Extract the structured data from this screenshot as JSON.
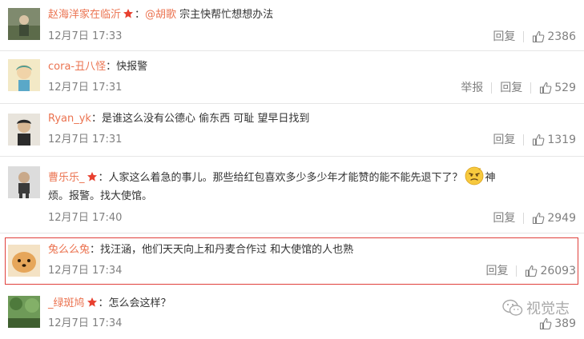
{
  "comments": [
    {
      "username": "赵海洋家在临沂",
      "separator": "：",
      "mention": "@胡歌",
      "text": " 宗主快帮忙想想办法",
      "time": "12月7日 17:33",
      "reply": "回复",
      "likes": "2386"
    },
    {
      "username": "cora-丑八怪",
      "separator": "：",
      "text": "快报警",
      "time": "12月7日 17:31",
      "report": "举报",
      "reply": "回复",
      "likes": "529"
    },
    {
      "username": "Ryan_yk",
      "separator": "：",
      "text": "是谁这么没有公德心 偷东西 可耻 望早日找到",
      "time": "12月7日 17:31",
      "reply": "回复",
      "likes": "1319"
    },
    {
      "username": "曹乐乐_",
      "separator": "：",
      "text": "人家这么着急的事儿。那些给红包喜欢多少多少年才能赞的能不能先退下了？",
      "text_after_emoji": "神",
      "text_line2": "烦。报警。找大使馆。",
      "time": "12月7日 17:40",
      "reply": "回复",
      "likes": "2949"
    },
    {
      "username": "兔么么兔",
      "separator": "：",
      "text": "找汪涵，他们天天向上和丹麦合作过 和大使馆的人也熟",
      "time": "12月7日 17:34",
      "reply": "回复",
      "likes": "26093"
    },
    {
      "username": "_绿斑鸠",
      "separator": "：",
      "text": "怎么会这样？",
      "time": "12月7日 17:34",
      "likes": "389"
    }
  ],
  "watermark": "视觉志",
  "colors": {
    "username": "#eb7350",
    "highlight_border": "#e0403b",
    "meta": "#808080"
  }
}
